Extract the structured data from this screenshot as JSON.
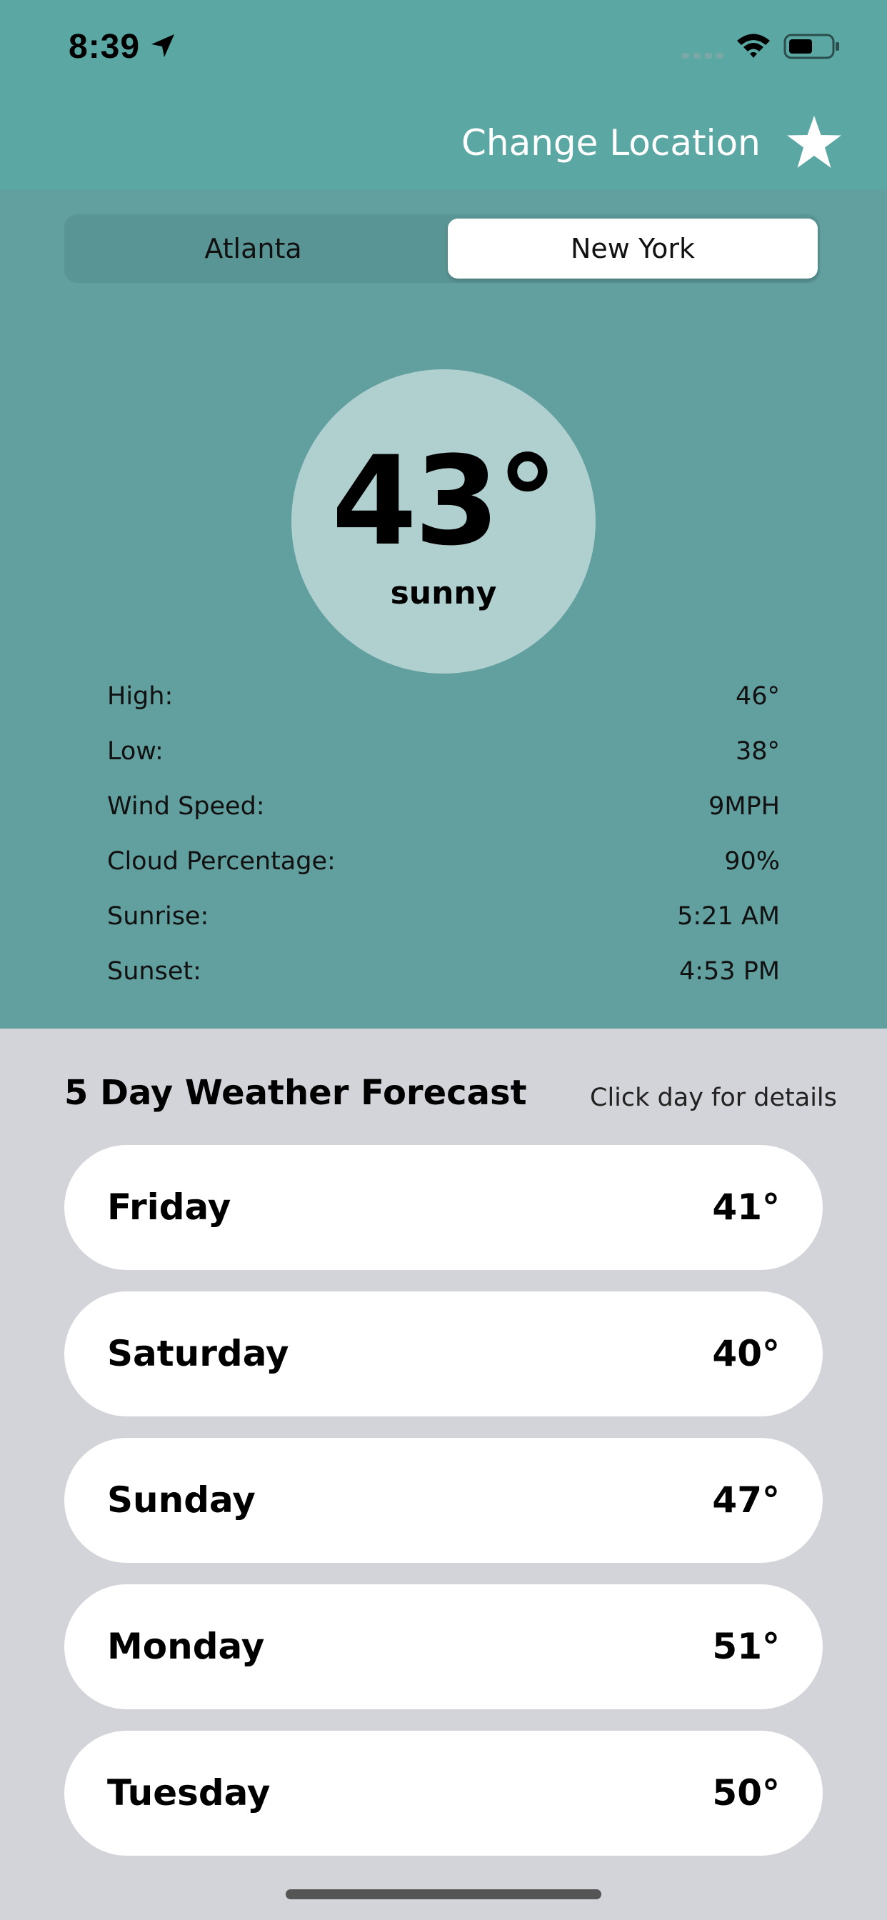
{
  "status_bar": {
    "time": "8:39"
  },
  "header": {
    "change_location_label": "Change Location",
    "favorite_icon": "star-icon"
  },
  "city_selector": {
    "options": [
      "Atlanta",
      "New York"
    ],
    "selected": "New York"
  },
  "current": {
    "temperature": "43°",
    "condition": "sunny"
  },
  "details": [
    {
      "label": "High:",
      "value": "46°"
    },
    {
      "label": "Low:",
      "value": "38°"
    },
    {
      "label": "Wind Speed:",
      "value": "9MPH"
    },
    {
      "label": "Cloud Percentage:",
      "value": "90%"
    },
    {
      "label": "Sunrise:",
      "value": "5:21 AM"
    },
    {
      "label": "Sunset:",
      "value": "4:53 PM"
    }
  ],
  "forecast": {
    "title": "5 Day Weather Forecast",
    "hint": "Click day for details",
    "days": [
      {
        "day": "Friday",
        "temp": "41°"
      },
      {
        "day": "Saturday",
        "temp": "40°"
      },
      {
        "day": "Sunday",
        "temp": "47°"
      },
      {
        "day": "Monday",
        "temp": "51°"
      },
      {
        "day": "Tuesday",
        "temp": "50°"
      }
    ]
  },
  "colors": {
    "header_bg": "#5aa7a4",
    "panel_bg": "#629f9f",
    "circle_bg": "#b0d0d0",
    "forecast_bg": "#d3d3da"
  }
}
